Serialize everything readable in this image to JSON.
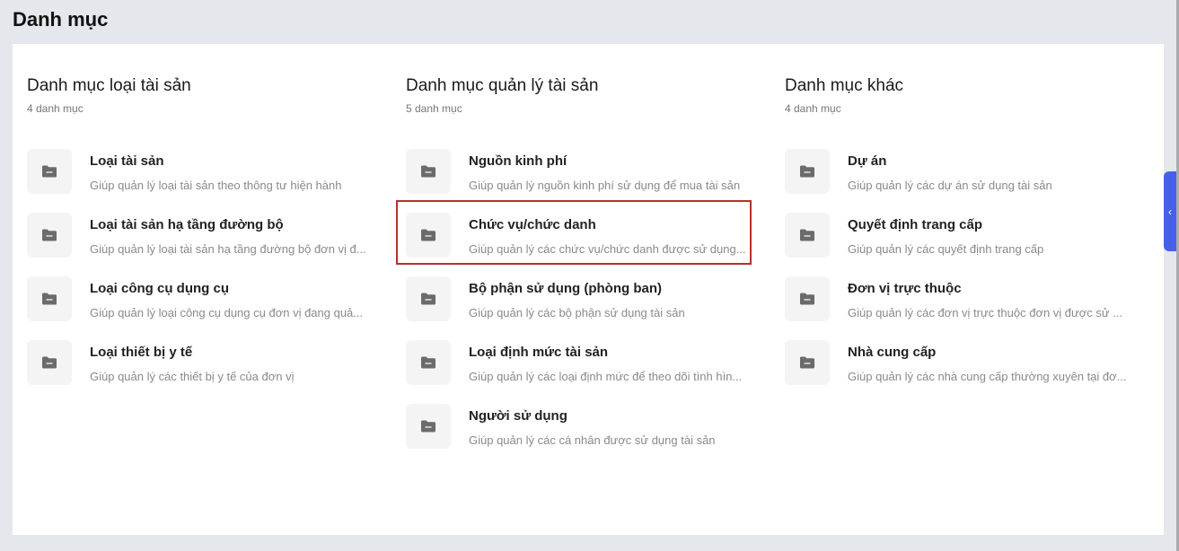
{
  "page_title": "Danh mục",
  "colors": {
    "accent": "#4760e8",
    "highlight": "#b3312d",
    "icon": "#6b6b6b"
  },
  "columns": [
    {
      "title": "Danh mục loại tài sản",
      "count": "4 danh mục",
      "items": [
        {
          "title": "Loại tài sản",
          "desc": "Giúp quản lý loại tài sản theo thông tư hiện hành"
        },
        {
          "title": "Loại tài sản hạ tầng đường bộ",
          "desc": "Giúp quản lý loại tài sản hạ tầng đường bộ đơn vị đ..."
        },
        {
          "title": "Loại công cụ dụng cụ",
          "desc": "Giúp quản lý loại công cụ dụng cụ đơn vị đang quả..."
        },
        {
          "title": "Loại thiết bị y tế",
          "desc": "Giúp quản lý các thiết bị y tế của đơn vị"
        }
      ]
    },
    {
      "title": "Danh mục quản lý tài sản",
      "count": "5 danh mục",
      "items": [
        {
          "title": "Nguồn kinh phí",
          "desc": "Giúp quản lý nguồn kinh phí sử dụng để mua tài sản"
        },
        {
          "title": "Chức vụ/chức danh",
          "desc": "Giúp quản lý các chức vụ/chức danh được sử dụng..."
        },
        {
          "title": "Bộ phận sử dụng (phòng ban)",
          "desc": "Giúp quản lý các bộ phận sử dụng tài sản"
        },
        {
          "title": "Loại định mức tài sản",
          "desc": "Giúp quản lý các loại định mức để theo dõi tình hìn..."
        },
        {
          "title": "Người sử dụng",
          "desc": "Giúp quản lý các cá nhân được sử dụng tài sản"
        }
      ]
    },
    {
      "title": "Danh mục khác",
      "count": "4 danh mục",
      "items": [
        {
          "title": "Dự án",
          "desc": "Giúp quản lý các dự án sử dụng tài sản"
        },
        {
          "title": "Quyết định trang cấp",
          "desc": "Giúp quản lý các quyết định trang cấp"
        },
        {
          "title": "Đơn vị trực thuộc",
          "desc": "Giúp quản lý các đơn vị trực thuộc đơn vị được sử ..."
        },
        {
          "title": "Nhà cung cấp",
          "desc": "Giúp quản lý các nhà cung cấp thường xuyên tại đơ..."
        }
      ]
    }
  ],
  "side_tab_icon": "chevron-left-icon"
}
